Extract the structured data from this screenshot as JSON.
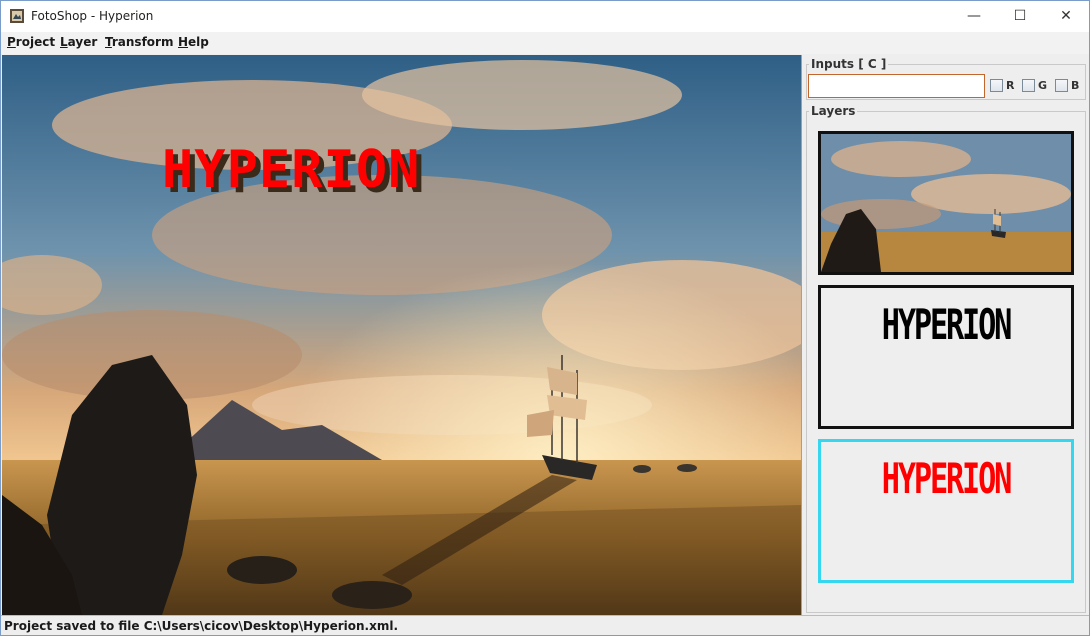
{
  "window": {
    "title": "FotoShop - Hyperion",
    "controls": {
      "minimize": "—",
      "maximize": "☐",
      "close": "✕"
    }
  },
  "menu": [
    {
      "mnemonic": "P",
      "rest": "roject"
    },
    {
      "mnemonic": "L",
      "rest": "ayer"
    },
    {
      "mnemonic": "T",
      "rest": "ransform"
    },
    {
      "mnemonic": "H",
      "rest": "elp"
    }
  ],
  "canvas": {
    "overlay_text": "HYPERION",
    "overlay_color": "#ff0000",
    "shadow_color": "#3a2a1a"
  },
  "inputs": {
    "title": "Inputs [ C ]",
    "value": "",
    "channels": [
      {
        "label": "R",
        "checked": false
      },
      {
        "label": "G",
        "checked": false
      },
      {
        "label": "B",
        "checked": false
      }
    ]
  },
  "layers": {
    "title": "Layers",
    "items": [
      {
        "kind": "image",
        "selected": false
      },
      {
        "kind": "text",
        "text": "HYPERION",
        "color": "#000000",
        "selected": false
      },
      {
        "kind": "text",
        "text": "HYPERION",
        "color": "#ff0000",
        "selected": true
      }
    ],
    "selected_border_color": "#35d7f0"
  },
  "status": {
    "text": "Project saved to file C:\\Users\\cicov\\Desktop\\Hyperion.xml."
  }
}
